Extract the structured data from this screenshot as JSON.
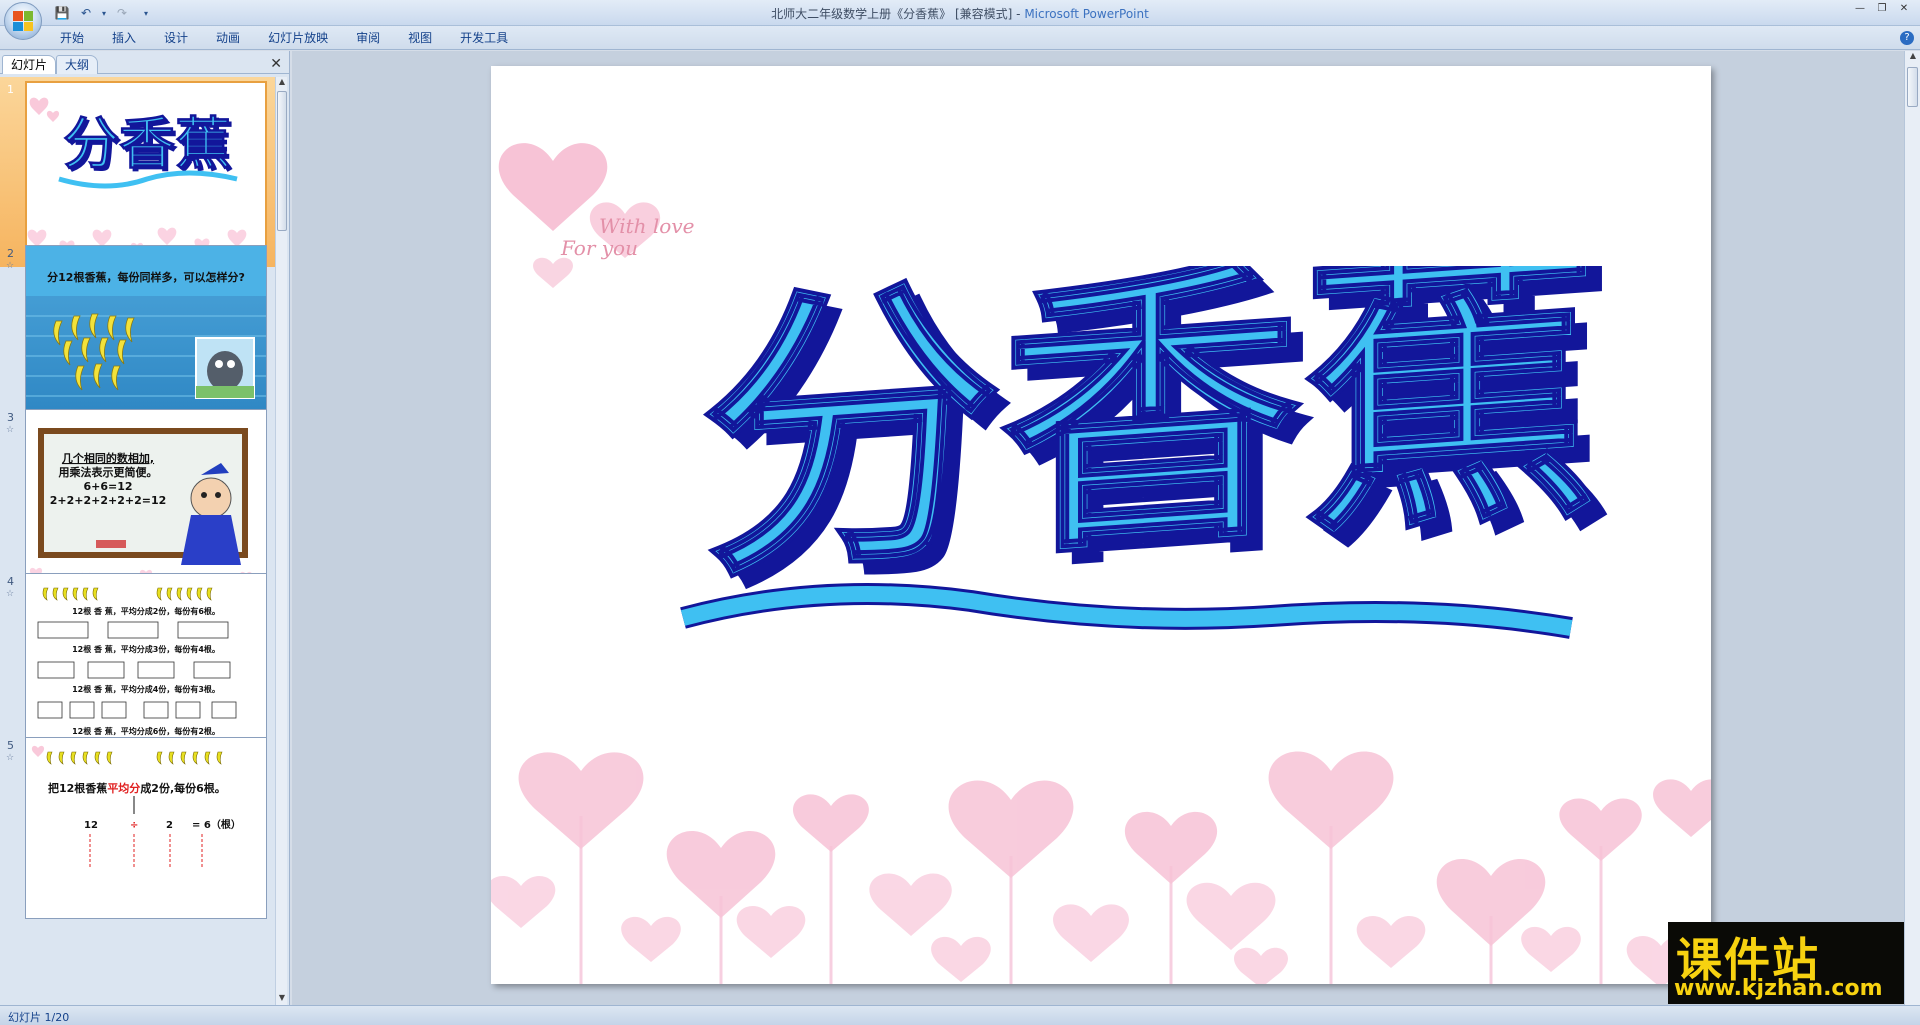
{
  "window": {
    "title": "北师大二年级数学上册《分香蕉》 [兼容模式] - ",
    "app_name": "Microsoft PowerPoint"
  },
  "ribbon": {
    "tabs": [
      "开始",
      "插入",
      "设计",
      "动画",
      "幻灯片放映",
      "审阅",
      "视图",
      "开发工具"
    ]
  },
  "left_pane": {
    "tabs": [
      "幻灯片",
      "大纲"
    ],
    "slides": [
      {
        "number": "1",
        "title": "分香蕉"
      },
      {
        "number": "2",
        "title": "分12根香蕉，每份同样多，可以怎样分?"
      },
      {
        "number": "3",
        "lines": [
          "几个相同的数相加,",
          "用乘法表示更简便。",
          "6+6=12",
          "2+2+2+2+2+2=12"
        ]
      },
      {
        "number": "4",
        "lines": [
          "12根 香 蕉，平均分成2份，每份有6根。",
          "12根 香 蕉，平均分成3份，每份有4根。",
          "12根 香 蕉，平均分成4份，每份有3根。",
          "12根 香 蕉，平均分成6份，每份有2根。"
        ]
      },
      {
        "number": "5",
        "text_before": "把12根香蕉",
        "text_highlight": "平均分",
        "text_after": "成2份,每份6根。",
        "equation": [
          "12",
          "÷",
          "2",
          "= 6（根）"
        ]
      }
    ]
  },
  "slide": {
    "title": "分香蕉",
    "deco_line1": "With love",
    "deco_line2": "For you"
  },
  "status": {
    "text": "幻灯片 1/20"
  },
  "watermark": {
    "logo": "课件站",
    "url": "www.kjzhan.com"
  },
  "colors": {
    "title_fill": "#3fc0f2",
    "title_shadow": "#12169a",
    "heart": "#f7c3d6"
  }
}
